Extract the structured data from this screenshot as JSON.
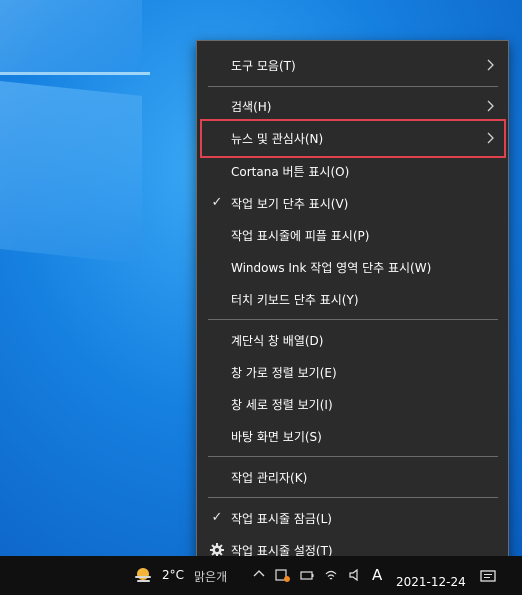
{
  "menu": {
    "items": [
      {
        "label": "도구 모음(T)",
        "has_submenu": true,
        "checked": false
      },
      {
        "label": "검색(H)",
        "has_submenu": true,
        "checked": false
      },
      {
        "label": "뉴스 및 관심사(N)",
        "has_submenu": true,
        "checked": false,
        "highlighted": true
      },
      {
        "label": "Cortana 버튼 표시(O)",
        "has_submenu": false,
        "checked": false
      },
      {
        "label": "작업 보기 단추 표시(V)",
        "has_submenu": false,
        "checked": true
      },
      {
        "label": "작업 표시줄에 피플 표시(P)",
        "has_submenu": false,
        "checked": false
      },
      {
        "label": "Windows Ink 작업 영역 단추 표시(W)",
        "has_submenu": false,
        "checked": false
      },
      {
        "label": "터치 키보드 단추 표시(Y)",
        "has_submenu": false,
        "checked": false
      },
      {
        "label": "계단식 창 배열(D)",
        "has_submenu": false,
        "checked": false
      },
      {
        "label": "창 가로 정렬 보기(E)",
        "has_submenu": false,
        "checked": false
      },
      {
        "label": "창 세로 정렬 보기(I)",
        "has_submenu": false,
        "checked": false
      },
      {
        "label": "바탕 화면 보기(S)",
        "has_submenu": false,
        "checked": false
      },
      {
        "label": "작업 관리자(K)",
        "has_submenu": false,
        "checked": false
      },
      {
        "label": "작업 표시줄 잠금(L)",
        "has_submenu": false,
        "checked": true
      },
      {
        "label": "작업 표시줄 설정(T)",
        "has_submenu": false,
        "checked": false,
        "icon": "gear-icon"
      }
    ]
  },
  "taskbar": {
    "temperature": "2°C",
    "condition": "맑은개",
    "weather_icon": "sun-fog-icon",
    "ime_indicator": "A",
    "date": "2021-12-24"
  },
  "colors": {
    "menu_bg": "#2b2b2b",
    "highlight_border": "#e0414f",
    "taskbar_bg": "#101010",
    "desktop_accent": "#1278d6"
  }
}
